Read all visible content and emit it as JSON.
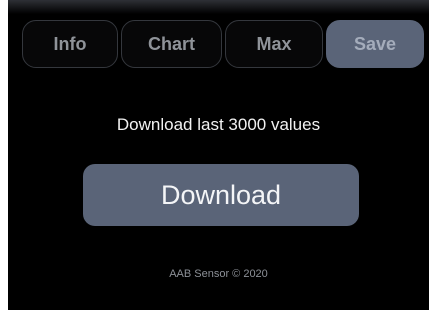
{
  "tabs": {
    "info": "Info",
    "chart": "Chart",
    "max": "Max",
    "save": "Save",
    "active": "save"
  },
  "main": {
    "download_label": "Download last 3000 values",
    "download_button": "Download"
  },
  "footer": {
    "text": "AAB Sensor © 2020"
  },
  "colors": {
    "background": "#000000",
    "tab_border": "#34373d",
    "tab_text": "#8f9399",
    "accent": "#5a6478",
    "button_text": "#f4f5f7"
  }
}
